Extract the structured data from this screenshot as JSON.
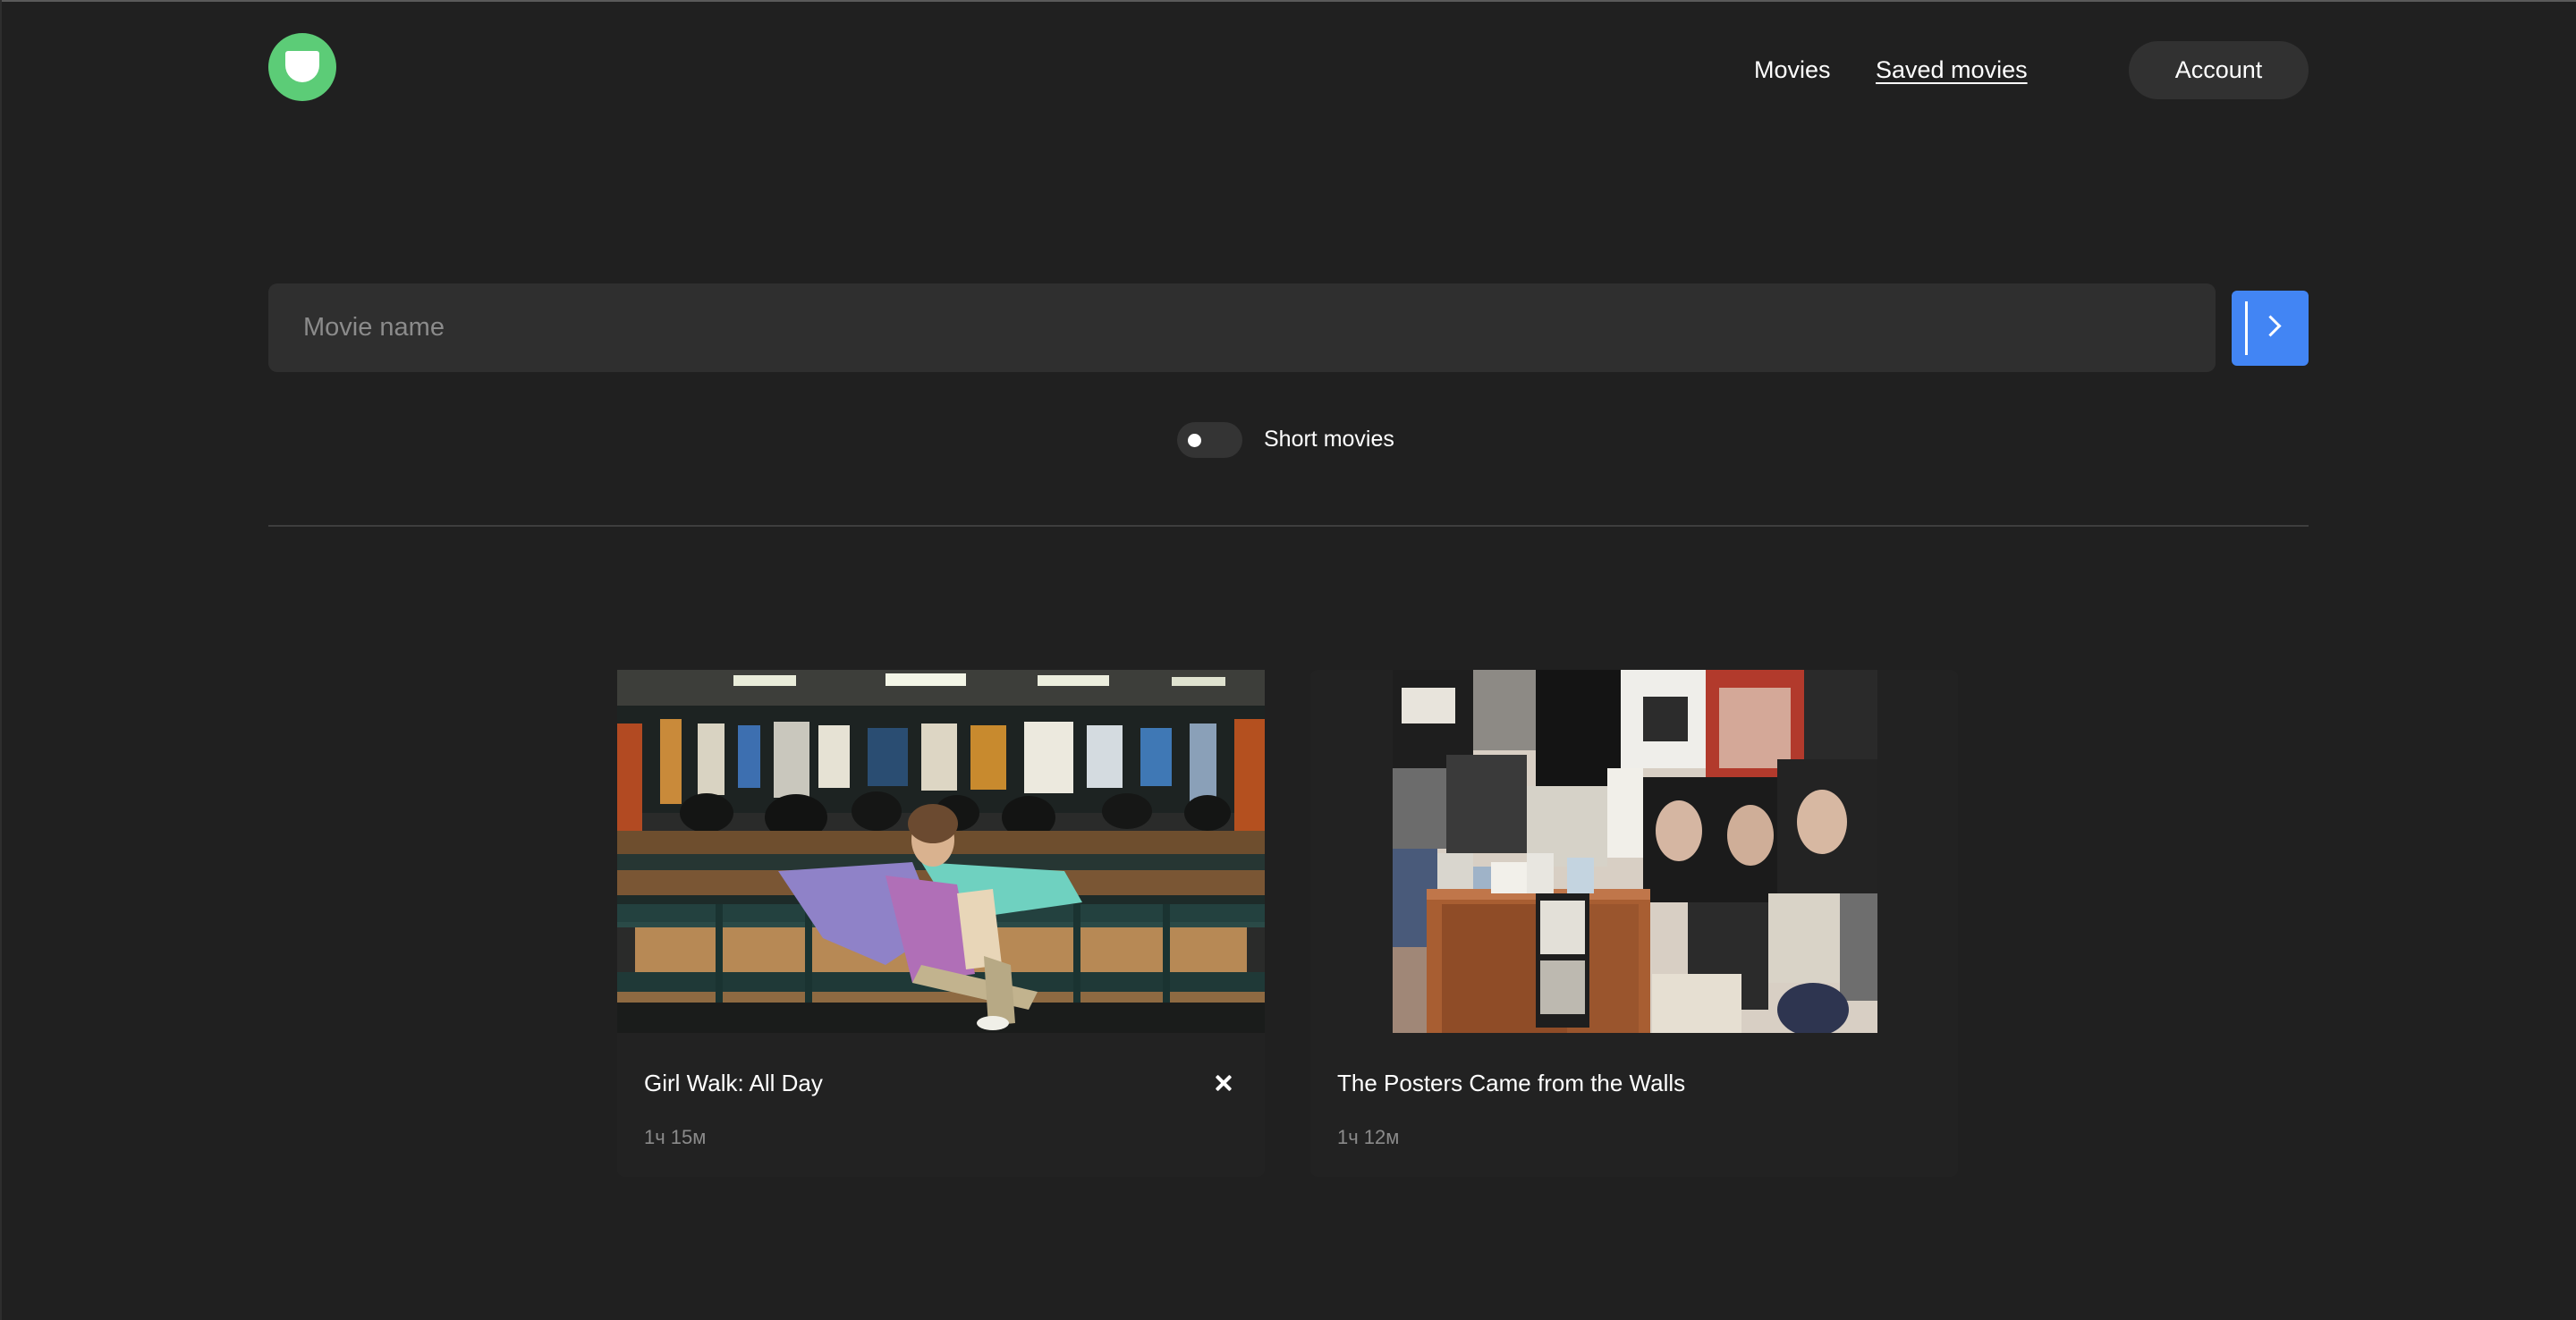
{
  "header": {
    "logo_icon": "app-logo-icon",
    "nav": {
      "movies_label": "Movies",
      "saved_label": "Saved movies"
    },
    "account_label": "Account"
  },
  "search": {
    "placeholder": "Movie name",
    "value": "",
    "submit_icon": "chevron-right-icon",
    "accent_color": "#4285f4"
  },
  "filter": {
    "short_label": "Short movies",
    "short_enabled": false
  },
  "movies": [
    {
      "title": "Girl Walk: All Day",
      "duration": "1ч 15м",
      "saved": true,
      "remove_icon": "close-icon"
    },
    {
      "title": "The Posters Came from the Walls",
      "duration": "1ч 12м",
      "saved": false
    }
  ],
  "colors": {
    "background": "#202020",
    "logo": "#5ccc77",
    "accent": "#4285f4"
  }
}
